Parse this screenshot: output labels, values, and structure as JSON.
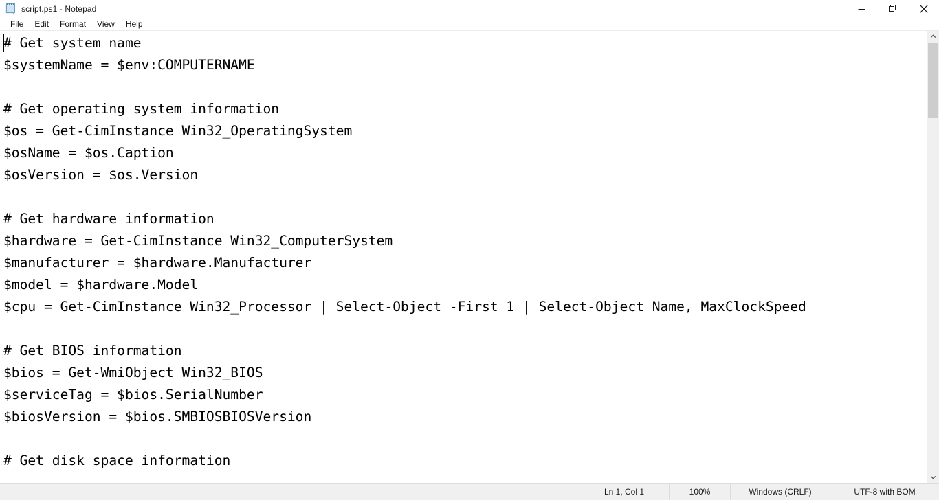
{
  "window": {
    "title": "script.ps1 - Notepad",
    "icon": "notepad-icon",
    "controls": {
      "minimize": "minimize-icon",
      "restore": "restore-icon",
      "close": "close-icon"
    }
  },
  "menubar": {
    "items": [
      {
        "label": "File"
      },
      {
        "label": "Edit"
      },
      {
        "label": "Format"
      },
      {
        "label": "View"
      },
      {
        "label": "Help"
      }
    ]
  },
  "editor": {
    "content": "# Get system name\n$systemName = $env:COMPUTERNAME\n\n# Get operating system information\n$os = Get-CimInstance Win32_OperatingSystem\n$osName = $os.Caption\n$osVersion = $os.Version\n\n# Get hardware information\n$hardware = Get-CimInstance Win32_ComputerSystem\n$manufacturer = $hardware.Manufacturer\n$model = $hardware.Model\n$cpu = Get-CimInstance Win32_Processor | Select-Object -First 1 | Select-Object Name, MaxClockSpeed\n\n# Get BIOS information\n$bios = Get-WmiObject Win32_BIOS\n$serviceTag = $bios.SerialNumber\n$biosVersion = $bios.SMBIOSBIOSVersion\n\n# Get disk space information"
  },
  "scrollbar": {
    "up_arrow": "chevron-up-icon",
    "down_arrow": "chevron-down-icon"
  },
  "statusbar": {
    "cursor_position": "Ln 1, Col 1",
    "zoom": "100%",
    "line_endings": "Windows (CRLF)",
    "encoding": "UTF-8 with BOM"
  },
  "colors": {
    "window_bg": "#ffffff",
    "statusbar_bg": "#f0f0f0",
    "scroll_thumb": "#cdcdcd",
    "text": "#000000"
  }
}
